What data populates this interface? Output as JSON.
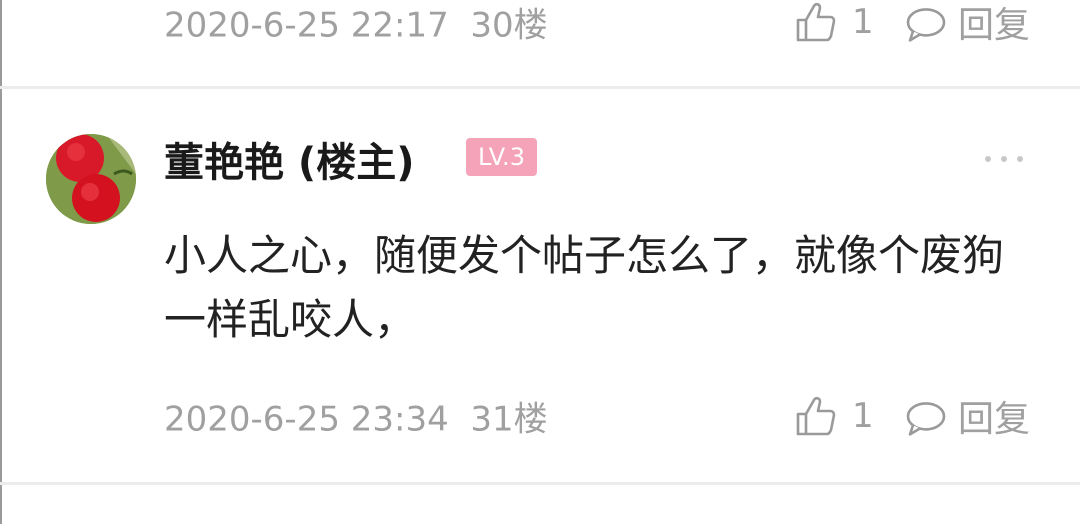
{
  "posts": [
    {
      "time": "2020-6-25 22:17",
      "floor": "30楼",
      "likes": "1",
      "reply_label": "回复"
    },
    {
      "author": "董艳艳 (楼主)",
      "level": "LV.3",
      "content": "小人之心，随便发个帖子怎么了，就像个废狗一样乱咬人，",
      "time": "2020-6-25 23:34",
      "floor": "31楼",
      "likes": "1",
      "reply_label": "回复"
    }
  ],
  "colors": {
    "badge": "#f5a3b8",
    "meta_text": "#a0a0a0"
  },
  "icons": {
    "like": "thumbs-up-icon",
    "reply": "speech-bubble-icon",
    "more": "more-dots-icon",
    "avatar": "red-fruit-avatar"
  }
}
